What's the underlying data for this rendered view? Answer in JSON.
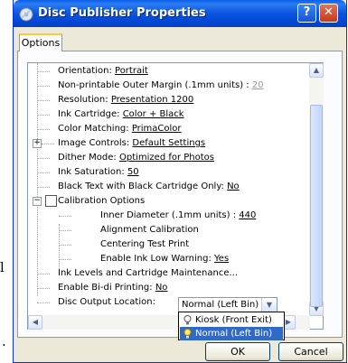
{
  "window": {
    "title": "Disc Publisher Properties",
    "help_label": "?",
    "close_label": "✕"
  },
  "tabs": [
    "Options"
  ],
  "tree": {
    "orientation": {
      "label": "Orientation: ",
      "value": "Portrait"
    },
    "margin": {
      "label": "Non-printable Outer Margin (.1mm units) : ",
      "value": "20"
    },
    "resolution": {
      "label": "Resolution: ",
      "value": "Presentation 1200"
    },
    "ink_cartridge": {
      "label": "Ink Cartridge: ",
      "value": "Color + Black"
    },
    "color_matching": {
      "label": "Color Matching: ",
      "value": "PrimaColor"
    },
    "image_controls": {
      "label": "Image Controls: ",
      "value": "Default Settings"
    },
    "dither_mode": {
      "label": "Dither Mode: ",
      "value": "Optimized for Photos"
    },
    "ink_saturation": {
      "label": "Ink Saturation: ",
      "value": "50"
    },
    "black_text": {
      "label": "Black Text with Black Cartridge Only: ",
      "value": "No"
    },
    "calibration": {
      "label": "Calibration Options",
      "inner_diameter": {
        "label": "Inner Diameter (.1mm units) : ",
        "value": "440"
      },
      "alignment": "Alignment Calibration",
      "centering": "Centering Test Print",
      "low_warning": {
        "label": "Enable Ink Low Warning: ",
        "value": "Yes"
      }
    },
    "ink_levels": "Ink Levels and Cartridge Maintenance...",
    "bidi": {
      "label": "Enable Bi-di Printing: ",
      "value": "No"
    },
    "disc_output": {
      "label": "Disc Output Location:",
      "value": "Normal (Left Bin)"
    }
  },
  "dropdown_options": [
    "Kiosk (Front Exit)",
    "Normal (Left Bin)"
  ],
  "buttons": {
    "ok": "OK",
    "cancel": "Cancel"
  },
  "stray_text": [
    "l",
    "."
  ]
}
